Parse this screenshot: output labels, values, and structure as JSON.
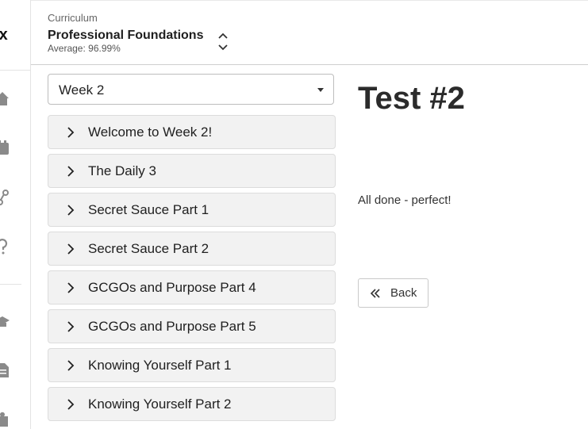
{
  "app": {
    "logo_text": "x"
  },
  "rail": {
    "icons": [
      "home-icon",
      "calendar-icon",
      "pathway-icon",
      "help-icon",
      "graduation-cap-icon",
      "document-icon",
      "puzzle-icon"
    ]
  },
  "header": {
    "eyebrow": "Curriculum",
    "title": "Professional Foundations",
    "subtitle": "Average: 96.99%"
  },
  "week_select": {
    "value": "Week 2"
  },
  "lessons": [
    {
      "label": "Welcome to Week 2!"
    },
    {
      "label": "The Daily 3"
    },
    {
      "label": "Secret Sauce Part 1"
    },
    {
      "label": "Secret Sauce Part 2"
    },
    {
      "label": "GCGOs and Purpose Part 4"
    },
    {
      "label": "GCGOs and Purpose Part 5"
    },
    {
      "label": "Knowing Yourself Part 1"
    },
    {
      "label": "Knowing Yourself Part 2"
    }
  ],
  "content": {
    "title": "Test #2",
    "message": "All done - perfect!",
    "back_label": "Back"
  },
  "colors": {
    "lesson_bg": "#f2f2f2",
    "border": "#dcdcdc",
    "icon_gray": "#8a8a8a"
  }
}
